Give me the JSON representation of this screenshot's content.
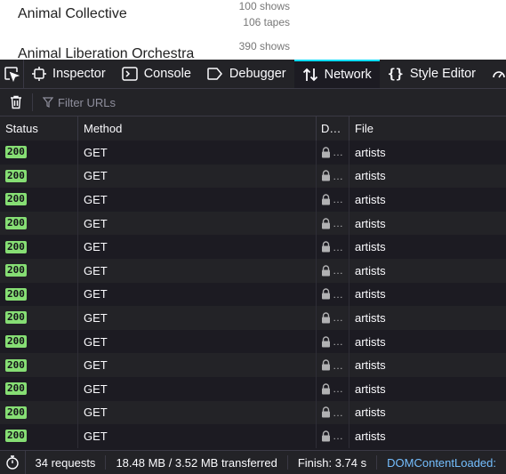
{
  "page": {
    "artists": [
      {
        "name": "Animal Collective",
        "shows": "100 shows",
        "tapes": "106 tapes"
      },
      {
        "name": "Animal Liberation Orchestra",
        "shows": "390 shows"
      }
    ]
  },
  "toolbar": {
    "tabs": [
      {
        "label": "Inspector",
        "icon": "inspector-icon"
      },
      {
        "label": "Console",
        "icon": "console-icon"
      },
      {
        "label": "Debugger",
        "icon": "debugger-icon"
      },
      {
        "label": "Network",
        "icon": "network-icon",
        "active": true
      },
      {
        "label": "Style Editor",
        "icon": "style-editor-icon"
      }
    ]
  },
  "filter": {
    "placeholder": "Filter URLs"
  },
  "table": {
    "headers": {
      "status": "Status",
      "method": "Method",
      "domain": "D…",
      "file": "File"
    },
    "rows": [
      {
        "status": "200",
        "method": "GET",
        "domain": "…",
        "file": "artists"
      },
      {
        "status": "200",
        "method": "GET",
        "domain": "…",
        "file": "artists"
      },
      {
        "status": "200",
        "method": "GET",
        "domain": "…",
        "file": "artists"
      },
      {
        "status": "200",
        "method": "GET",
        "domain": "…",
        "file": "artists"
      },
      {
        "status": "200",
        "method": "GET",
        "domain": "…",
        "file": "artists"
      },
      {
        "status": "200",
        "method": "GET",
        "domain": "…",
        "file": "artists"
      },
      {
        "status": "200",
        "method": "GET",
        "domain": "…",
        "file": "artists"
      },
      {
        "status": "200",
        "method": "GET",
        "domain": "…",
        "file": "artists"
      },
      {
        "status": "200",
        "method": "GET",
        "domain": "…",
        "file": "artists"
      },
      {
        "status": "200",
        "method": "GET",
        "domain": "…",
        "file": "artists"
      },
      {
        "status": "200",
        "method": "GET",
        "domain": "…",
        "file": "artists"
      },
      {
        "status": "200",
        "method": "GET",
        "domain": "…",
        "file": "artists"
      },
      {
        "status": "200",
        "method": "GET",
        "domain": "…",
        "file": "artists"
      }
    ]
  },
  "statusbar": {
    "requests": "34 requests",
    "transferred": "18.48 MB / 3.52 MB transferred",
    "finish": "Finish: 3.74 s",
    "dcl": "DOMContentLoaded:"
  },
  "colors": {
    "accent": "#00ddff",
    "status_ok": "#86de74",
    "dcl": "#75bfff"
  }
}
